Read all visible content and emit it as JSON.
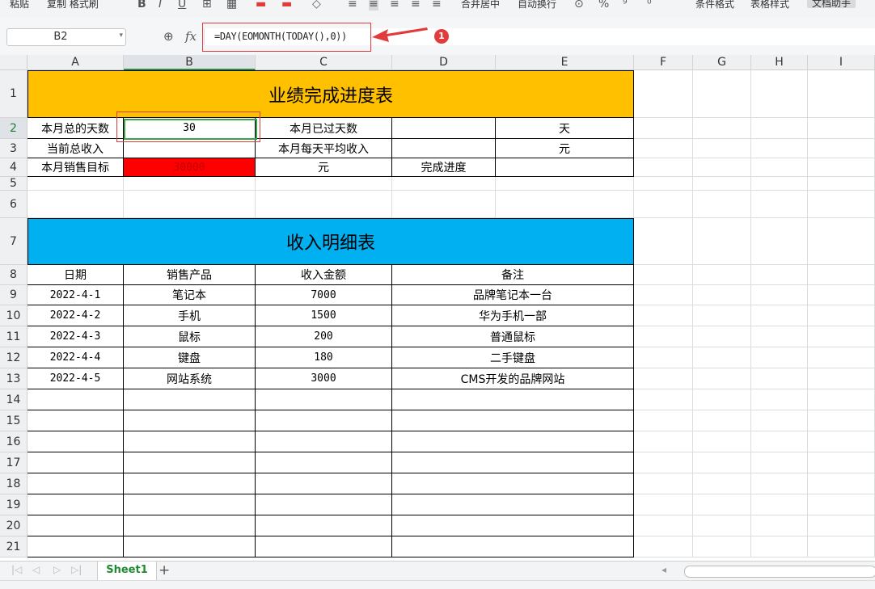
{
  "toolbar": {
    "paste": "粘贴",
    "copy_format": "复制 格式刷",
    "merge_center": "合并居中",
    "wrap_text": "自动换行",
    "cond_format": "条件格式",
    "table_style": "表格样式",
    "doc_assist": "文档助手"
  },
  "formula_bar": {
    "name_box": "B2",
    "fx_label": "fx",
    "formula": "=DAY(EOMONTH(TODAY(),0))",
    "callout_number": "1"
  },
  "columns": [
    "A",
    "B",
    "C",
    "D",
    "E",
    "F",
    "G",
    "H",
    "I"
  ],
  "rows": [
    "1",
    "2",
    "3",
    "4",
    "5",
    "6",
    "7",
    "8",
    "9",
    "10",
    "11",
    "12",
    "13",
    "14",
    "15",
    "16",
    "17",
    "18",
    "19",
    "20",
    "21"
  ],
  "progress_table": {
    "title": "业绩完成进度表",
    "days_in_month_label": "本月总的天数",
    "days_in_month_value": "30",
    "days_passed_label": "本月已过天数",
    "days_passed_value": "",
    "unit_day": "天",
    "current_income_label": "当前总收入",
    "current_income_value": "",
    "avg_daily_income_label": "本月每天平均收入",
    "avg_daily_income_value": "",
    "unit_yuan": "元",
    "sales_target_label": "本月销售目标",
    "sales_target_value": "30000",
    "unit_yuan_2": "元",
    "completion_label": "完成进度",
    "completion_value": ""
  },
  "income_table": {
    "title": "收入明细表",
    "headers": [
      "日期",
      "销售产品",
      "收入金额",
      "备注"
    ],
    "rows": [
      [
        "2022-4-1",
        "笔记本",
        "7000",
        "品牌笔记本一台"
      ],
      [
        "2022-4-2",
        "手机",
        "1500",
        "华为手机一部"
      ],
      [
        "2022-4-3",
        "鼠标",
        "200",
        "普通鼠标"
      ],
      [
        "2022-4-4",
        "键盘",
        "180",
        "二手键盘"
      ],
      [
        "2022-4-5",
        "网站系统",
        "3000",
        "CMS开发的品牌网站"
      ]
    ]
  },
  "sheet_tabs": {
    "active": "Sheet1",
    "add": "+"
  },
  "colors": {
    "title1_bg": "#ffc000",
    "title2_bg": "#00b0f0",
    "target_bg": "#ff0000",
    "active_cell_border": "#3aa24a",
    "annotation_red": "#e23b3b"
  }
}
